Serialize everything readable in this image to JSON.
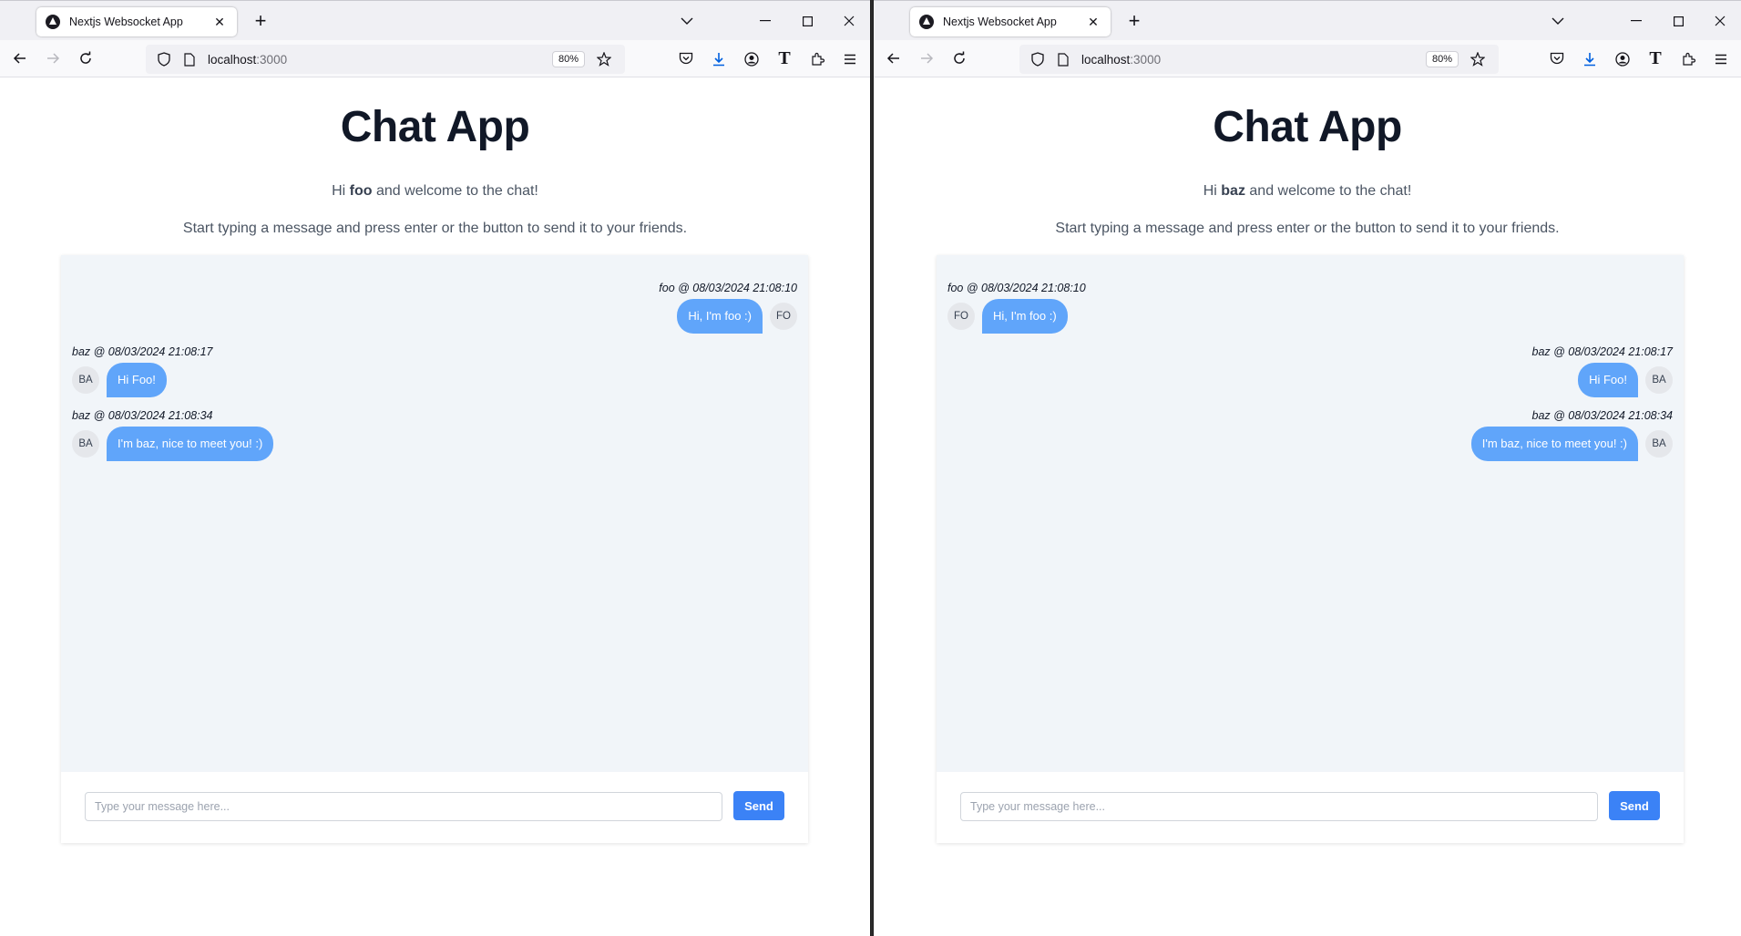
{
  "windows": [
    {
      "tab_title": "Nextjs Websocket App",
      "url_host": "localhost",
      "url_port": ":3000",
      "zoom": "80%",
      "page": {
        "title": "Chat App",
        "greeting_prefix": "Hi ",
        "username": "foo",
        "greeting_suffix": " and welcome to the chat!",
        "instructions": "Start typing a message and press enter or the button to send it to your friends.",
        "input_placeholder": "Type your message here...",
        "send_label": "Send",
        "messages": [
          {
            "meta": "foo @ 08/03/2024 21:08:10",
            "text": "Hi, I'm foo :)",
            "avatar": "FO",
            "own": true
          },
          {
            "meta": "baz @ 08/03/2024 21:08:17",
            "text": "Hi Foo!",
            "avatar": "BA",
            "own": false
          },
          {
            "meta": "baz @ 08/03/2024 21:08:34",
            "text": "I'm baz, nice to meet you! :)",
            "avatar": "BA",
            "own": false
          }
        ]
      }
    },
    {
      "tab_title": "Nextjs Websocket App",
      "url_host": "localhost",
      "url_port": ":3000",
      "zoom": "80%",
      "page": {
        "title": "Chat App",
        "greeting_prefix": "Hi ",
        "username": "baz",
        "greeting_suffix": " and welcome to the chat!",
        "instructions": "Start typing a message and press enter or the button to send it to your friends.",
        "input_placeholder": "Type your message here...",
        "send_label": "Send",
        "messages": [
          {
            "meta": "foo @ 08/03/2024 21:08:10",
            "text": "Hi, I'm foo :)",
            "avatar": "FO",
            "own": false
          },
          {
            "meta": "baz @ 08/03/2024 21:08:17",
            "text": "Hi Foo!",
            "avatar": "BA",
            "own": true
          },
          {
            "meta": "baz @ 08/03/2024 21:08:34",
            "text": "I'm baz, nice to meet you! :)",
            "avatar": "BA",
            "own": true
          }
        ]
      }
    }
  ],
  "toolbar_icons": [
    "back-icon",
    "forward-icon",
    "reload-icon",
    "shield-icon",
    "page-icon",
    "star-icon",
    "pocket-icon",
    "download-icon",
    "account-icon",
    "t-extension-icon",
    "extensions-icon",
    "menu-icon"
  ],
  "t_extension_label": "T",
  "colors": {
    "accent": "#3b82f6",
    "bubble": "#60a5fa",
    "chat_bg": "#f1f5f9"
  }
}
